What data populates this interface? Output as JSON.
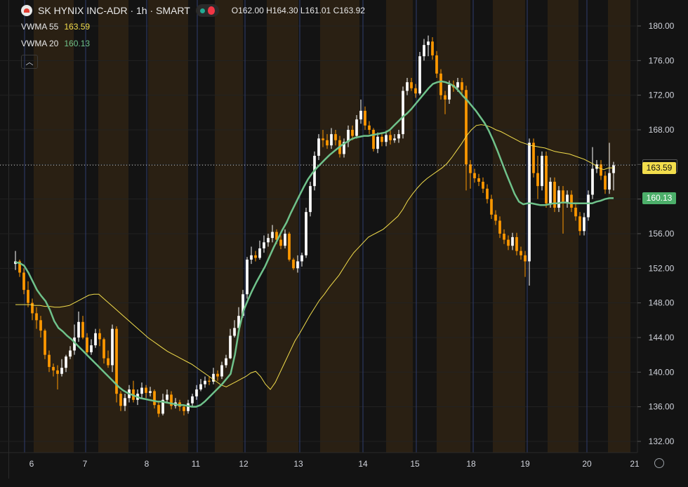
{
  "header": {
    "symbol_title": "SK HYNIX INC-ADR · 1h · SMART",
    "ohlc": "O162.00 H164.30 L161.01 C163.92"
  },
  "indicators": [
    {
      "name": "VWMA 55",
      "value": "163.59",
      "color": "#f2dd4c"
    },
    {
      "name": "VWMA 20",
      "value": "160.13",
      "color": "#6fc28b"
    }
  ],
  "price_tags": {
    "last": "163.92",
    "vwma55": "163.59",
    "vwma20": "160.13"
  },
  "colors": {
    "up": "#ffffff",
    "down": "#ff9800",
    "vwma55": "#f2dd4c",
    "vwma20": "#6fc28b",
    "background": "#131313",
    "session_shade": "#2a2013",
    "day_line": "#2f3c6e"
  },
  "chart_data": {
    "type": "candlestick",
    "title": "SK HYNIX INC-ADR · 1h · SMART",
    "x_tick_labels": [
      "6",
      "7",
      "8",
      "11",
      "12",
      "13",
      "14",
      "15",
      "18",
      "19",
      "20",
      "21"
    ],
    "y_tick_labels": [
      "132.00",
      "136.00",
      "140.00",
      "144.00",
      "148.00",
      "152.00",
      "156.00",
      "160.00",
      "164.00",
      "168.00",
      "172.00",
      "176.00",
      "180.00"
    ],
    "ylim": [
      130.7,
      183.0
    ],
    "grid": true,
    "last_price": 163.92,
    "candles": [
      [
        152.5,
        152.8,
        154.0,
        151.8
      ],
      [
        152.8,
        151.5,
        153.0,
        151.0
      ],
      [
        151.5,
        149.5,
        152.0,
        149.0
      ],
      [
        149.5,
        148.0,
        150.5,
        147.5
      ],
      [
        148.0,
        146.8,
        148.5,
        146.0
      ],
      [
        146.8,
        146.0,
        147.5,
        145.0
      ],
      [
        146.0,
        144.8,
        146.5,
        144.0
      ],
      [
        144.8,
        142.0,
        145.0,
        141.5
      ],
      [
        142.0,
        140.6,
        142.5,
        140.0
      ],
      [
        140.6,
        140.2,
        141.0,
        139.5
      ],
      [
        140.2,
        139.8,
        140.8,
        138.0
      ],
      [
        139.8,
        140.5,
        141.5,
        139.5
      ],
      [
        140.5,
        141.8,
        142.0,
        140.0
      ],
      [
        141.8,
        142.5,
        143.0,
        141.5
      ],
      [
        142.5,
        144.0,
        145.5,
        142.0
      ],
      [
        144.0,
        145.8,
        147.0,
        143.5
      ],
      [
        145.8,
        144.0,
        146.5,
        143.8
      ],
      [
        144.0,
        142.3,
        144.5,
        142.0
      ],
      [
        142.3,
        143.1,
        143.8,
        142.0
      ],
      [
        143.1,
        144.5,
        145.0,
        142.8
      ],
      [
        144.5,
        143.8,
        145.0,
        143.0
      ],
      [
        143.8,
        141.6,
        144.0,
        141.0
      ],
      [
        141.6,
        140.8,
        142.5,
        140.5
      ],
      [
        140.8,
        145.0,
        145.5,
        140.0
      ],
      [
        145.0,
        137.5,
        145.3,
        136.5
      ],
      [
        137.5,
        136.1,
        137.8,
        135.5
      ],
      [
        136.1,
        137.0,
        137.5,
        135.5
      ],
      [
        137.0,
        138.0,
        138.5,
        136.5
      ],
      [
        138.0,
        136.8,
        139.0,
        136.5
      ],
      [
        136.8,
        137.5,
        138.0,
        136.2
      ],
      [
        137.5,
        138.2,
        138.8,
        137.0
      ],
      [
        138.2,
        137.6,
        138.5,
        137.0
      ],
      [
        137.6,
        137.8,
        138.3,
        137.2
      ],
      [
        137.8,
        136.2,
        138.0,
        135.8
      ],
      [
        136.2,
        135.2,
        136.5,
        134.8
      ],
      [
        135.2,
        136.8,
        137.5,
        135.0
      ],
      [
        136.8,
        137.4,
        138.0,
        136.5
      ],
      [
        137.4,
        136.1,
        137.8,
        135.7
      ],
      [
        136.1,
        136.5,
        137.0,
        135.8
      ],
      [
        136.5,
        136.0,
        136.8,
        135.5
      ],
      [
        136.0,
        135.5,
        136.2,
        135.0
      ],
      [
        135.5,
        136.4,
        136.8,
        135.2
      ],
      [
        136.4,
        137.2,
        137.5,
        136.0
      ],
      [
        137.2,
        138.0,
        138.5,
        136.8
      ],
      [
        138.0,
        138.6,
        139.2,
        137.8
      ],
      [
        138.6,
        139.0,
        139.5,
        138.2
      ],
      [
        139.0,
        138.9,
        139.5,
        138.5
      ],
      [
        138.9,
        139.8,
        140.5,
        138.6
      ],
      [
        139.8,
        139.5,
        140.2,
        139.0
      ],
      [
        139.5,
        140.8,
        141.2,
        139.2
      ],
      [
        140.8,
        141.6,
        142.0,
        140.5
      ],
      [
        141.6,
        144.2,
        145.0,
        141.5
      ],
      [
        144.2,
        145.1,
        146.0,
        144.0
      ],
      [
        145.1,
        146.5,
        147.5,
        144.8
      ],
      [
        146.5,
        149.0,
        149.5,
        146.3
      ],
      [
        149.0,
        153.0,
        153.3,
        148.5
      ],
      [
        153.0,
        153.5,
        154.5,
        152.5
      ],
      [
        153.5,
        153.2,
        154.0,
        152.8
      ],
      [
        153.2,
        154.3,
        155.2,
        153.0
      ],
      [
        154.3,
        155.0,
        155.8,
        153.8
      ],
      [
        155.0,
        155.5,
        156.0,
        154.5
      ],
      [
        155.5,
        156.2,
        157.0,
        155.0
      ],
      [
        156.2,
        155.3,
        156.5,
        154.8
      ],
      [
        155.3,
        154.6,
        155.8,
        154.2
      ],
      [
        154.6,
        156.0,
        156.5,
        154.3
      ],
      [
        156.0,
        153.0,
        156.2,
        152.8
      ],
      [
        153.0,
        152.0,
        153.2,
        151.8
      ],
      [
        152.0,
        152.8,
        153.5,
        151.5
      ],
      [
        152.8,
        153.5,
        153.8,
        152.2
      ],
      [
        153.5,
        158.5,
        159.0,
        153.2
      ],
      [
        158.5,
        161.5,
        162.0,
        158.0
      ],
      [
        161.5,
        165.0,
        165.5,
        161.0
      ],
      [
        165.0,
        167.0,
        167.5,
        164.5
      ],
      [
        167.0,
        166.8,
        168.0,
        166.0
      ],
      [
        166.8,
        166.2,
        167.5,
        165.8
      ],
      [
        166.2,
        167.5,
        168.2,
        165.8
      ],
      [
        167.5,
        166.8,
        168.0,
        166.2
      ],
      [
        166.8,
        165.2,
        167.3,
        164.8
      ],
      [
        165.2,
        166.6,
        167.0,
        164.8
      ],
      [
        166.6,
        168.0,
        168.5,
        166.0
      ],
      [
        168.0,
        167.3,
        168.5,
        166.8
      ],
      [
        167.3,
        169.2,
        169.7,
        167.0
      ],
      [
        169.2,
        170.2,
        171.5,
        168.7
      ],
      [
        170.2,
        168.5,
        170.7,
        168.0
      ],
      [
        168.5,
        168.0,
        169.0,
        167.5
      ],
      [
        168.0,
        165.8,
        168.2,
        165.5
      ],
      [
        165.8,
        167.2,
        167.7,
        165.3
      ],
      [
        167.2,
        166.6,
        167.7,
        166.1
      ],
      [
        166.6,
        167.4,
        167.9,
        166.1
      ],
      [
        167.4,
        166.8,
        167.9,
        166.3
      ],
      [
        166.8,
        167.0,
        167.5,
        166.5
      ],
      [
        167.0,
        167.5,
        168.0,
        166.5
      ],
      [
        167.5,
        172.5,
        173.0,
        167.0
      ],
      [
        172.5,
        173.5,
        174.0,
        172.0
      ],
      [
        173.5,
        172.8,
        174.0,
        172.5
      ],
      [
        172.8,
        172.2,
        173.3,
        171.7
      ],
      [
        172.2,
        176.5,
        177.0,
        172.0
      ],
      [
        176.5,
        177.8,
        178.5,
        176.0
      ],
      [
        177.8,
        178.2,
        178.9,
        176.5
      ],
      [
        178.2,
        176.6,
        178.7,
        176.1
      ],
      [
        176.6,
        174.5,
        177.1,
        174.0
      ],
      [
        174.5,
        172.0,
        175.0,
        171.5
      ],
      [
        172.0,
        171.5,
        172.5,
        169.8
      ],
      [
        171.5,
        173.2,
        173.7,
        171.0
      ],
      [
        173.2,
        172.9,
        173.7,
        172.4
      ],
      [
        172.9,
        173.5,
        174.0,
        172.4
      ],
      [
        173.5,
        172.6,
        174.0,
        172.1
      ],
      [
        172.6,
        164.0,
        173.1,
        161.0
      ],
      [
        164.0,
        163.0,
        164.5,
        161.2
      ],
      [
        163.0,
        162.4,
        163.5,
        161.9
      ],
      [
        162.4,
        162.0,
        162.9,
        161.5
      ],
      [
        162.0,
        161.2,
        162.5,
        160.7
      ],
      [
        161.2,
        160.0,
        161.7,
        159.5
      ],
      [
        160.0,
        158.2,
        160.5,
        157.7
      ],
      [
        158.2,
        157.5,
        158.7,
        157.0
      ],
      [
        157.5,
        156.0,
        158.0,
        155.5
      ],
      [
        156.0,
        155.3,
        156.5,
        154.8
      ],
      [
        155.3,
        154.6,
        155.8,
        154.1
      ],
      [
        154.6,
        155.6,
        156.1,
        154.1
      ],
      [
        155.6,
        154.0,
        156.1,
        153.5
      ],
      [
        154.0,
        153.5,
        154.5,
        153.0
      ],
      [
        153.5,
        152.8,
        154.0,
        151.0
      ],
      [
        152.8,
        166.5,
        167.0,
        150.0
      ],
      [
        166.5,
        163.0,
        167.0,
        162.5
      ],
      [
        163.0,
        161.5,
        165.0,
        160.0
      ],
      [
        161.5,
        165.0,
        165.5,
        161.0
      ],
      [
        165.0,
        159.5,
        165.5,
        159.0
      ],
      [
        159.5,
        162.0,
        162.5,
        159.0
      ],
      [
        162.0,
        159.0,
        162.5,
        158.5
      ],
      [
        159.0,
        161.0,
        161.5,
        158.5
      ],
      [
        161.0,
        159.5,
        161.5,
        156.0
      ],
      [
        159.5,
        160.5,
        161.0,
        159.0
      ],
      [
        160.5,
        159.0,
        161.0,
        158.5
      ],
      [
        159.0,
        158.0,
        159.5,
        157.5
      ],
      [
        158.0,
        156.3,
        158.5,
        155.8
      ],
      [
        156.3,
        157.9,
        158.4,
        155.8
      ],
      [
        157.9,
        160.5,
        161.0,
        157.5
      ],
      [
        160.5,
        163.5,
        166.0,
        160.0
      ],
      [
        163.5,
        164.0,
        164.5,
        163.0
      ],
      [
        164.0,
        162.7,
        164.5,
        162.2
      ],
      [
        162.7,
        161.1,
        163.2,
        160.6
      ],
      [
        161.1,
        163.0,
        166.5,
        160.6
      ],
      [
        163.0,
        163.9,
        164.3,
        161.0
      ]
    ],
    "vwma20": [
      152.7,
      152.6,
      152.3,
      151.5,
      150.5,
      149.5,
      148.8,
      148.2,
      147.2,
      145.9,
      145.1,
      144.7,
      144.2,
      143.8,
      143.3,
      142.8,
      142.3,
      141.8,
      141.3,
      140.8,
      140.3,
      139.8,
      139.3,
      138.8,
      138.3,
      137.9,
      137.6,
      137.4,
      137.2,
      137.0,
      136.9,
      136.8,
      136.7,
      136.6,
      136.6,
      136.5,
      136.4,
      136.3,
      136.2,
      136.2,
      136.1,
      136.0,
      136.0,
      136.2,
      136.6,
      137.1,
      137.6,
      138.1,
      138.6,
      139.2,
      139.8,
      142.0,
      145.0,
      147.1,
      148.3,
      149.4,
      150.4,
      151.3,
      152.2,
      153.3,
      154.4,
      155.4,
      156.4,
      157.3,
      158.4,
      159.4,
      160.4,
      161.4,
      162.3,
      163.0,
      163.6,
      164.1,
      164.6,
      165.1,
      165.5,
      165.9,
      166.3,
      166.6,
      166.9,
      167.1,
      167.2,
      167.3,
      167.3,
      167.4,
      167.5,
      167.6,
      167.7,
      168.0,
      168.5,
      169.0,
      169.5,
      169.9,
      170.4,
      171.0,
      171.6,
      172.2,
      172.8,
      173.3,
      173.5,
      173.6,
      173.5,
      173.3,
      173.0,
      172.5,
      171.9,
      171.4,
      170.8,
      170.2,
      169.5,
      168.8,
      167.9,
      166.8,
      165.6,
      164.3,
      163.0,
      161.8,
      160.6,
      159.7,
      159.4,
      159.5,
      159.5,
      159.4,
      159.3,
      159.3,
      159.4,
      159.5,
      159.5,
      159.6,
      159.6,
      159.5,
      159.5,
      159.5,
      159.5,
      159.5,
      159.5,
      159.7,
      159.8,
      160.0,
      160.1,
      160.1
    ],
    "vwma55": [
      147.8,
      147.8,
      147.8,
      147.8,
      147.7,
      147.7,
      147.6,
      147.6,
      147.5,
      147.5,
      147.6,
      147.7,
      148.0,
      148.3,
      148.6,
      148.9,
      149.0,
      149.0,
      148.5,
      148.0,
      147.5,
      147.0,
      146.5,
      146.0,
      145.5,
      145.0,
      144.5,
      144.0,
      143.6,
      143.2,
      142.8,
      142.4,
      142.1,
      141.8,
      141.5,
      141.2,
      140.9,
      140.5,
      140.1,
      139.7,
      139.3,
      138.9,
      138.5,
      138.3,
      138.6,
      138.9,
      139.2,
      139.5,
      139.9,
      140.1,
      139.5,
      138.6,
      138.0,
      138.8,
      140.0,
      141.2,
      142.4,
      143.6,
      144.5,
      145.5,
      146.5,
      147.4,
      148.3,
      149.0,
      149.8,
      150.5,
      151.2,
      152.1,
      153.0,
      153.8,
      154.4,
      155.0,
      155.6,
      155.9,
      156.2,
      156.5,
      157.0,
      157.5,
      158.0,
      158.8,
      159.8,
      160.6,
      161.3,
      161.9,
      162.4,
      162.8,
      163.2,
      163.6,
      164.1,
      164.8,
      165.6,
      166.4,
      167.3,
      168.0,
      168.5,
      168.6,
      168.5,
      168.3,
      168.0,
      167.8,
      167.5,
      167.2,
      166.9,
      166.6,
      166.4,
      166.2,
      166.1,
      166.0,
      165.9,
      165.7,
      165.5,
      165.4,
      165.3,
      165.2,
      165.0,
      164.8,
      164.6,
      164.3,
      164.0,
      163.6,
      163.4,
      163.6,
      163.6
    ]
  }
}
